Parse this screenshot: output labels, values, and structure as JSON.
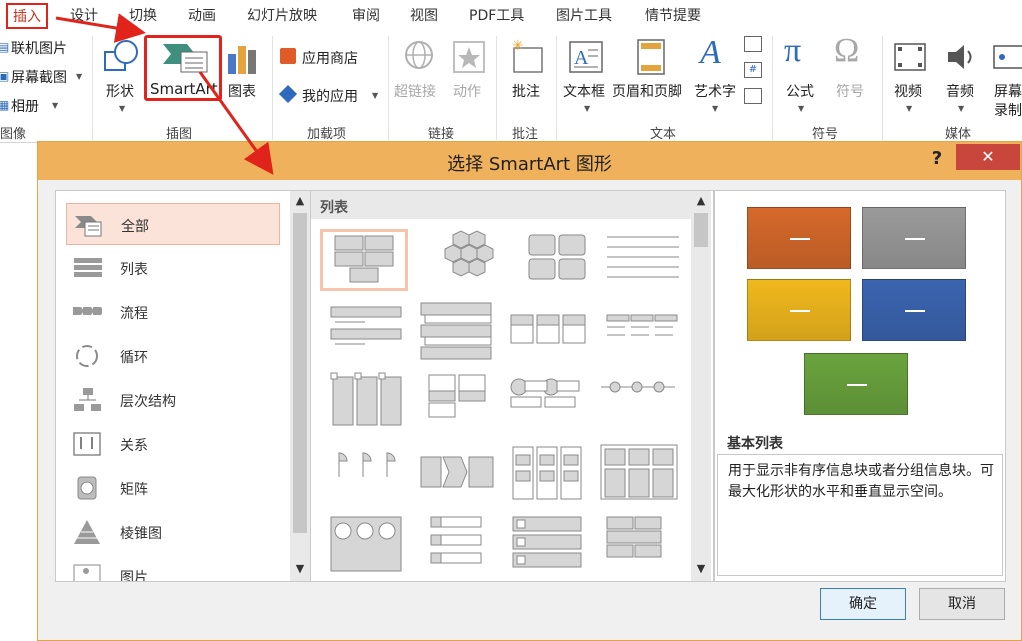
{
  "ribbon": {
    "tabs": [
      "插入",
      "设计",
      "切换",
      "动画",
      "幻灯片放映",
      "审阅",
      "视图",
      "PDF工具",
      "图片工具",
      "情节提要"
    ],
    "left_items": [
      "联机图片",
      "屏幕截图",
      "相册"
    ],
    "buttons": {
      "shapes": "形状",
      "smartart": "SmartArt",
      "chart": "图表",
      "app_store": "应用商店",
      "my_apps": "我的应用",
      "hyperlink": "超链接",
      "action": "动作",
      "comment": "批注",
      "textbox": "文本框",
      "header_footer": "页眉和页脚",
      "wordart": "艺术字",
      "equation": "公式",
      "symbol": "符号",
      "video": "视频",
      "audio": "音频",
      "screen_record_1": "屏幕",
      "screen_record_2": "录制"
    },
    "groups": [
      "图像",
      "插图",
      "加载项",
      "链接",
      "批注",
      "文本",
      "符号",
      "媒体"
    ]
  },
  "dialog": {
    "title": "选择 SmartArt 图形",
    "help": "?",
    "close": "✕",
    "categories": [
      {
        "label": "全部",
        "icon": "all-icon",
        "selected": true
      },
      {
        "label": "列表",
        "icon": "list-icon"
      },
      {
        "label": "流程",
        "icon": "process-icon"
      },
      {
        "label": "循环",
        "icon": "cycle-icon"
      },
      {
        "label": "层次结构",
        "icon": "hierarchy-icon"
      },
      {
        "label": "关系",
        "icon": "relationship-icon"
      },
      {
        "label": "矩阵",
        "icon": "matrix-icon"
      },
      {
        "label": "棱锥图",
        "icon": "pyramid-icon"
      },
      {
        "label": "图片",
        "icon": "picture-icon"
      }
    ],
    "layout_header": "列表",
    "preview": {
      "colors": [
        "#d5692b",
        "#9a9a9a",
        "#f0b81e",
        "#3b64b0",
        "#6aa33e"
      ],
      "title": "基本列表",
      "description": "用于显示非有序信息块或者分组信息块。可最大化形状的水平和垂直显示空间。"
    },
    "ok": "确定",
    "cancel": "取消"
  },
  "annotation": {
    "highlight_color": "#e0241b"
  }
}
